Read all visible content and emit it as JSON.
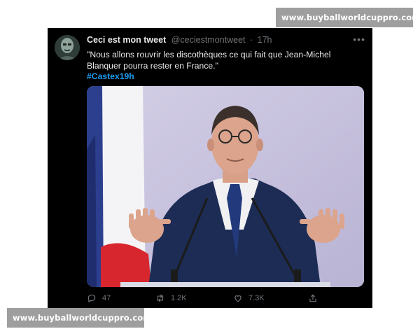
{
  "watermark": {
    "text": "www.buyballworldcuppro.com"
  },
  "tweet": {
    "display_name": "Ceci est mon tweet",
    "handle": "@ceciestmontweet",
    "separator": "·",
    "time": "17h",
    "more_label": "•••",
    "text": "\"Nous allons rouvrir les discothèques ce qui fait que Jean-Michel Blanquer pourra rester en France.\"",
    "hashtag": "#Castex19h",
    "stats": {
      "replies": "47",
      "retweets": "1.2K",
      "likes": "7.3K"
    }
  },
  "colors": {
    "background": "#000000",
    "text": "#e7e9ea",
    "muted": "#71767b",
    "link": "#1d9bf0",
    "watermark_bg": "#9e9e9e"
  },
  "icons": [
    "reply-icon",
    "retweet-icon",
    "like-icon",
    "share-icon",
    "more-icon"
  ]
}
